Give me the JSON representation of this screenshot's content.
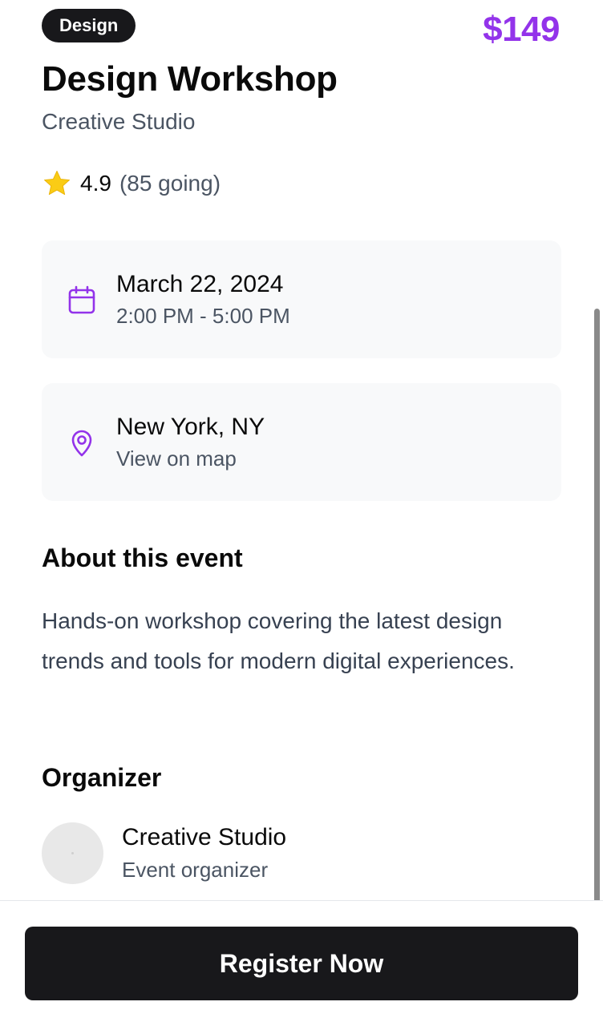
{
  "event": {
    "category": "Design",
    "price": "$149",
    "title": "Design Workshop",
    "host": "Creative Studio",
    "rating": "4.9",
    "attendance": "(85 going)"
  },
  "date_card": {
    "icon": "calendar-icon",
    "date": "March 22, 2024",
    "time": "2:00 PM - 5:00 PM"
  },
  "location_card": {
    "icon": "map-pin-icon",
    "place": "New York, NY",
    "link": "View on map"
  },
  "about": {
    "heading": "About this event",
    "description": "Hands-on workshop covering the latest design trends and tools for modern digital experiences."
  },
  "organizer": {
    "heading": "Organizer",
    "name": "Creative Studio",
    "role": "Event organizer"
  },
  "footer": {
    "register_label": "Register Now"
  },
  "colors": {
    "accent": "#9333ea",
    "dark": "#18181b",
    "star": "#facc15",
    "card_bg": "#f8f9fa"
  }
}
